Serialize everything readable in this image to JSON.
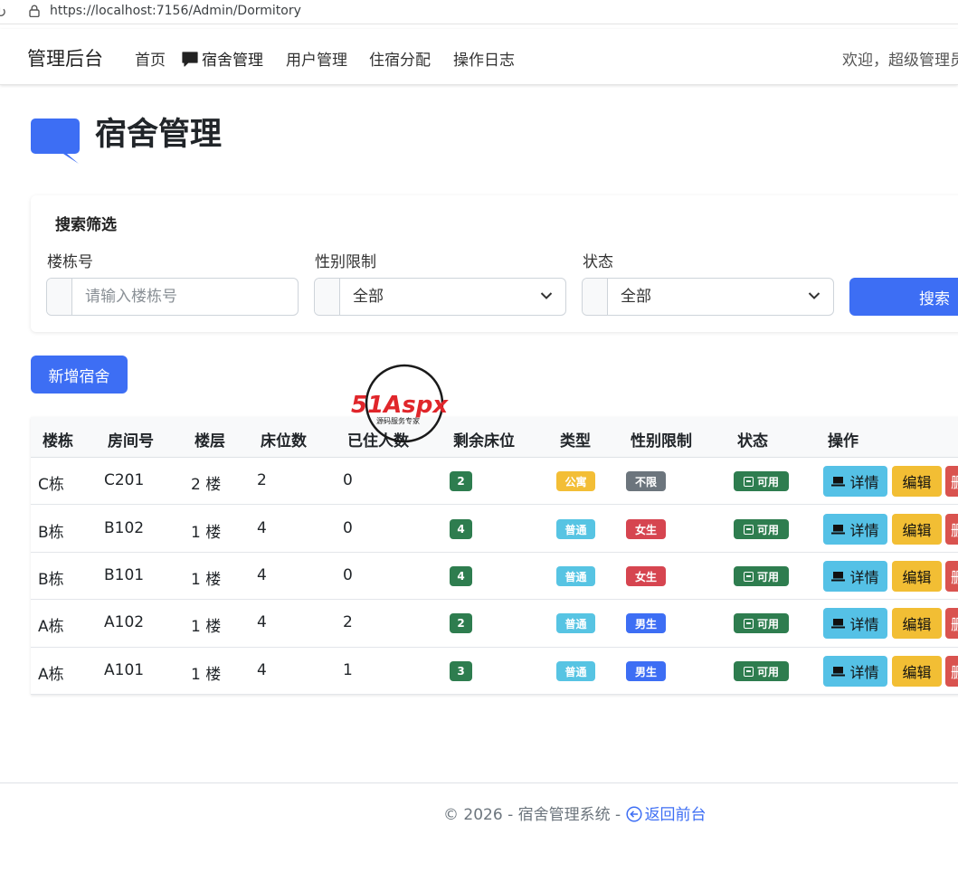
{
  "browser": {
    "url": "https://localhost:7156/Admin/Dormitory"
  },
  "nav": {
    "brand": "管理后台",
    "items": [
      "首页",
      "宿舍管理",
      "用户管理",
      "住宿分配",
      "操作日志"
    ],
    "welcome": "欢迎，超级管理员"
  },
  "page": {
    "title": "宿舍管理"
  },
  "search": {
    "title": "搜索筛选",
    "building_label": "楼栋号",
    "building_placeholder": "请输入楼栋号",
    "gender_label": "性别限制",
    "gender_value": "全部",
    "status_label": "状态",
    "status_value": "全部",
    "button": "搜索"
  },
  "add_button": "新增宿舍",
  "watermark": {
    "brand": "51Aspx",
    "slogan": "源码服务专家"
  },
  "table": {
    "headers": [
      "楼栋",
      "房间号",
      "楼层",
      "床位数",
      "已住人数",
      "剩余床位",
      "类型",
      "性别限制",
      "状态",
      "操作"
    ],
    "actions": {
      "detail": "详情",
      "edit": "编辑",
      "delete": "删除"
    },
    "rows": [
      {
        "building": "C栋",
        "room": "C201",
        "floor": "2 楼",
        "beds": "2",
        "occupied": "0",
        "remaining": "2",
        "type": "公寓",
        "gender": "不限",
        "status": "可用"
      },
      {
        "building": "B栋",
        "room": "B102",
        "floor": "1 楼",
        "beds": "4",
        "occupied": "0",
        "remaining": "4",
        "type": "普通",
        "gender": "女生",
        "status": "可用"
      },
      {
        "building": "B栋",
        "room": "B101",
        "floor": "1 楼",
        "beds": "4",
        "occupied": "0",
        "remaining": "4",
        "type": "普通",
        "gender": "女生",
        "status": "可用"
      },
      {
        "building": "A栋",
        "room": "A102",
        "floor": "1 楼",
        "beds": "4",
        "occupied": "2",
        "remaining": "2",
        "type": "普通",
        "gender": "男生",
        "status": "可用"
      },
      {
        "building": "A栋",
        "room": "A101",
        "floor": "1 楼",
        "beds": "4",
        "occupied": "1",
        "remaining": "3",
        "type": "普通",
        "gender": "男生",
        "status": "可用"
      }
    ]
  },
  "footer": {
    "copyright": "© 2026 - 宿舍管理系统 - ",
    "back_link": "返回前台"
  },
  "colors": {
    "primary": "#3d6ef4",
    "success": "#2e7d4f",
    "warning": "#f3be36",
    "info": "#57c4e3",
    "danger": "#d64550",
    "secondary": "#6c757d"
  }
}
